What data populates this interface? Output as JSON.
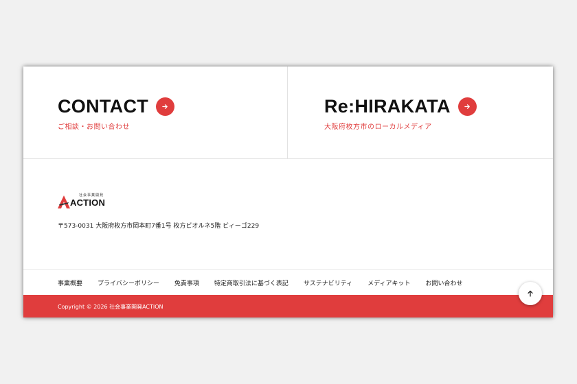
{
  "cta": [
    {
      "title": "CONTACT",
      "subtitle": "ご相談・お問い合わせ",
      "icon": "arrow-right-icon"
    },
    {
      "title": "Re:HIRAKATA",
      "subtitle": "大阪府枚方市のローカルメディア",
      "icon": "arrow-right-icon"
    }
  ],
  "logo": {
    "tagline": "社会事業開発",
    "name": "ACTION"
  },
  "address": "〒573-0031 大阪府枚方市岡本町7番1号 枚方ビオルネ5階 ビィーゴ229",
  "footer_nav": [
    "事業概要",
    "プライバシーポリシー",
    "免責事項",
    "特定商取引法に基づく表記",
    "サステナビリティ",
    "メディアキット",
    "お問い合わせ"
  ],
  "copyright": "Copyright © 2026 社会事業開発ACTION",
  "back_to_top_icon": "arrow-up-icon",
  "colors": {
    "accent": "#e03d3d",
    "background": "#f1f1f1",
    "panel": "#ffffff",
    "text": "#111111"
  }
}
